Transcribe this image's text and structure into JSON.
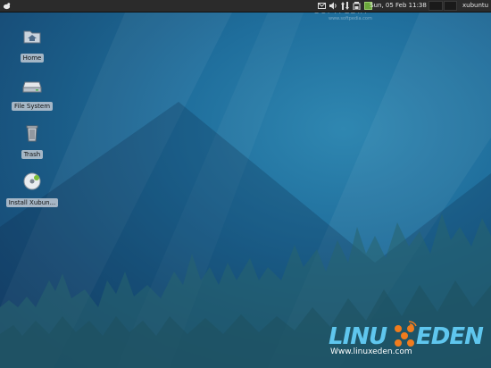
{
  "panel": {
    "clock": "Sun, 05 Feb  11:38",
    "user": "xubuntu",
    "tray_icons": [
      "mail-icon",
      "volume-icon",
      "network-icon",
      "power-icon",
      "update-icon"
    ]
  },
  "desktop": {
    "icons": [
      {
        "label": "Home",
        "icon": "folder-home-icon"
      },
      {
        "label": "File System",
        "icon": "drive-icon"
      },
      {
        "label": "Trash",
        "icon": "trash-icon"
      },
      {
        "label": "Install Xubun...",
        "icon": "install-disc-icon"
      }
    ]
  },
  "watermark": {
    "top": "SOFTPEDIA",
    "top_sub": "www.softpedia.com",
    "logo_left": "LINU",
    "logo_right": "EDEN",
    "logo_sub": "Www.linuxeden.com"
  },
  "colors": {
    "panel": "#2b2b2b",
    "desktop": "#1f6e9c",
    "logo": "#5fc6ee",
    "accent": "#f07c1e"
  }
}
